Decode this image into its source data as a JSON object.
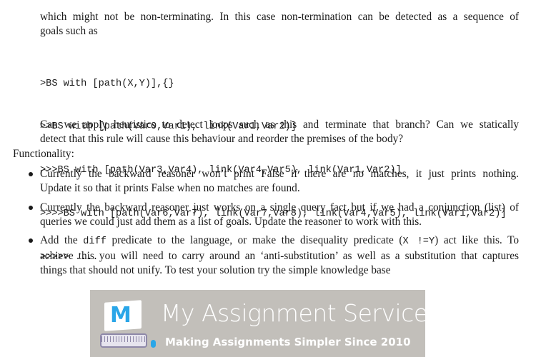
{
  "intro": {
    "lines": [
      "which might not be non-terminating. In this case non-termination can be detected as a sequence of",
      "goals such as"
    ]
  },
  "code_lines": [
    ">BS with [path(X,Y)],{}",
    ">>BS with [path(Var0,Var1), link(Var1,Var2)]",
    ">>>BS with [path(Var3,Var4), link(Var4,Var5), link(Var1,Var2)]",
    ">>>>BS with [path(Var6,Var7), link(Var7,Var8), link(Var4,Var5), link(Var1,Var2)]",
    ">>>>> ...."
  ],
  "question": {
    "lines": [
      "Can we apply heuristics to detect loops such as this and terminate that branch? Can we statically",
      "detect that this rule will cause this behaviour and reorder the premises of the body?"
    ]
  },
  "functionality_heading": "Functionality:",
  "bullets": [
    {
      "lines": [
        "Currently the backward reasoner won’t print False if there are no matches, it just prints nothing.",
        "Update it so that it prints False when no matches are found."
      ]
    },
    {
      "lines": [
        "Currently the backward reasoner just works on a single query fact but if we had a conjunction (list) of",
        "queries we could just add them as a list of goals. Update the reasoner to work with this."
      ]
    },
    {
      "line1_pre": "Add the ",
      "line1_code": "diff",
      "line1_mid": " predicate to the language, or make the disequality predicate (",
      "line1_code2": "X !=Y",
      "line1_post": ") act like this. To",
      "line2": "achieve this you will need to carry around an ‘anti-substitution’ as well as a substitution that captures",
      "line3": "things that should not unify. To test your solution try the simple knowledge base"
    }
  ],
  "watermark": {
    "logo_letter": "M",
    "title": "My Assignment Services",
    "tagline": "Making Assignments Simpler Since 2010",
    "colors": {
      "background": "#c2bfba",
      "accent": "#2aa6e8",
      "text": "#ffffff"
    }
  }
}
